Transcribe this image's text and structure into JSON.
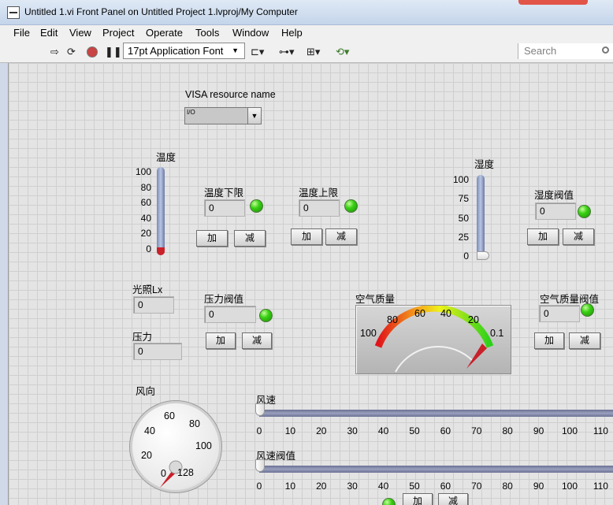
{
  "window": {
    "title": "Untitled 1.vi Front Panel on Untitled Project 1.lvproj/My Computer"
  },
  "menu": [
    "File",
    "Edit",
    "View",
    "Project",
    "Operate",
    "Tools",
    "Window",
    "Help"
  ],
  "toolbar": {
    "font": "17pt Application Font",
    "search_placeholder": "Search"
  },
  "visa": {
    "label": "VISA resource name",
    "prefix": "I/O"
  },
  "temp": {
    "label": "温度",
    "ticks": [
      "100",
      "80",
      "60",
      "40",
      "20",
      "0"
    ],
    "low": {
      "label": "温度下限",
      "value": "0"
    },
    "high": {
      "label": "温度上限",
      "value": "0"
    }
  },
  "hum": {
    "label": "湿度",
    "ticks": [
      "100",
      "75",
      "50",
      "25",
      "0"
    ],
    "thr": {
      "label": "湿度阀值",
      "value": "0"
    }
  },
  "light": {
    "label": "光照Lx",
    "value": "0"
  },
  "press": {
    "label": "压力",
    "value": "0",
    "thr": {
      "label": "压力阀值",
      "value": "0"
    }
  },
  "air": {
    "label": "空气质量",
    "ticks": [
      "100",
      "80",
      "60",
      "40",
      "20",
      "0.1"
    ],
    "thr": {
      "label": "空气质量阀值",
      "value": "0"
    }
  },
  "wind_dir": {
    "label": "风向",
    "ticks": [
      "60",
      "40",
      "20",
      "0",
      "128",
      "100",
      "80"
    ]
  },
  "wind": {
    "speed_label": "风速",
    "thr_label": "风速阀值",
    "ticks": [
      "0",
      "10",
      "20",
      "30",
      "40",
      "50",
      "60",
      "70",
      "80",
      "90",
      "100",
      "110"
    ]
  },
  "buttons": {
    "add": "加",
    "sub": "减"
  }
}
